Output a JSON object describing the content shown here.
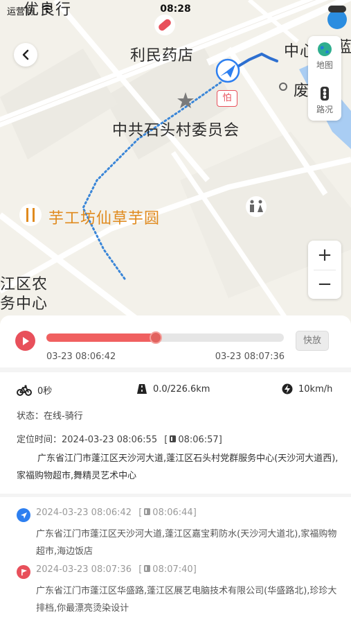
{
  "status_bar": {
    "carrier": "运营商",
    "time": "08:28"
  },
  "map": {
    "labels": {
      "top_left_partial": "优良行",
      "pharmacy": "利民药店",
      "committee": "中共石头村委员会",
      "dessert": "芋工坊仙草芋圆",
      "left_partial_1": "江区农",
      "left_partial_2": "务中心",
      "right_partial_1": "中心",
      "right_partial_2": "蓝",
      "right_partial_3": "废品站",
      "parking": "怕"
    },
    "controls": {
      "map_label": "地图",
      "traffic_label": "路况",
      "zoom_in": "+",
      "zoom_out": "−"
    }
  },
  "player": {
    "progress": 0.46,
    "start_time": "03-23 08:06:42",
    "end_time": "03-23 08:07:36",
    "speed_label": "快放"
  },
  "stats": {
    "duration": "0秒",
    "distance": "0.0/226.6km",
    "speed": "10km/h"
  },
  "info": {
    "status": "状态：在线-骑行",
    "locate_time_label": "定位时间：",
    "locate_time": "2024-03-23 08:06:55",
    "locate_time_alt": "08:06:57",
    "address": "广东省江门市蓬江区天沙河大道,蓬江区石头村党群服务中心(天沙河大道西),家福购物超市,舞精灵艺术中心"
  },
  "events": [
    {
      "type": "start",
      "time": "2024-03-23 08:06:42",
      "time_alt": "08:06:44",
      "address": "广东省江门市蓬江区天沙河大道,蓬江区嘉宝莉防水(天沙河大道北),家福购物超市,海边饭店",
      "color": "#2d7ff0"
    },
    {
      "type": "end",
      "time": "2024-03-23 08:07:36",
      "time_alt": "08:07:40",
      "address": "广东省江门市蓬江区华盛路,蓬江区展艺电脑技术有限公司(华盛路北),珍珍大排档,你最漂亮烫染设计",
      "color": "#e8505b"
    }
  ],
  "colors": {
    "accent": "#f06060",
    "route": "#2d7ff0",
    "label_orange": "#e08a1e"
  }
}
